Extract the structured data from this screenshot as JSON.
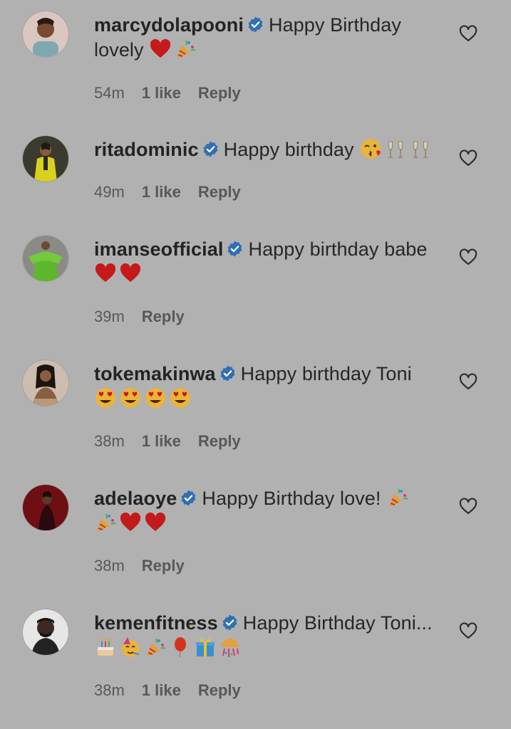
{
  "comments": [
    {
      "username": "marcydolapooni",
      "text": "Happy Birthday",
      "text_line2": "lovely",
      "emojis": [
        "red-heart",
        "party-popper"
      ],
      "time": "54m",
      "likes": "1 like",
      "reply": "Reply"
    },
    {
      "username": "ritadominic",
      "text": "Happy birthday",
      "emojis": [
        "kissing-face",
        "clinking-glasses",
        "clinking-glasses"
      ],
      "time": "49m",
      "likes": "1 like",
      "reply": "Reply"
    },
    {
      "username": "imanseofficial",
      "text": "Happy birthday babe",
      "emojis": [
        "red-heart",
        "red-heart"
      ],
      "time": "39m",
      "likes": "",
      "reply": "Reply"
    },
    {
      "username": "tokemakinwa",
      "text": "Happy birthday Toni",
      "emojis": [
        "heart-eyes-face",
        "heart-eyes-face",
        "heart-eyes-face",
        "heart-eyes-face"
      ],
      "time": "38m",
      "likes": "1 like",
      "reply": "Reply"
    },
    {
      "username": "adelaoye",
      "text": "Happy Birthday love!",
      "emojis": [
        "party-popper",
        "party-popper",
        "red-heart",
        "red-heart"
      ],
      "time": "38m",
      "likes": "",
      "reply": "Reply"
    },
    {
      "username": "kemenfitness",
      "text": "Happy Birthday Toni...",
      "emojis": [
        "birthday-cake",
        "partying-face",
        "party-popper",
        "balloon",
        "wrapped-gift",
        "confetti-ball"
      ],
      "time": "38m",
      "likes": "1 like",
      "reply": "Reply"
    }
  ],
  "colors": {
    "background": "#b1b1b1",
    "verified": "#2f6fb3",
    "text": "#262626",
    "meta": "#585858",
    "heart_emoji": "#c41a1a"
  }
}
